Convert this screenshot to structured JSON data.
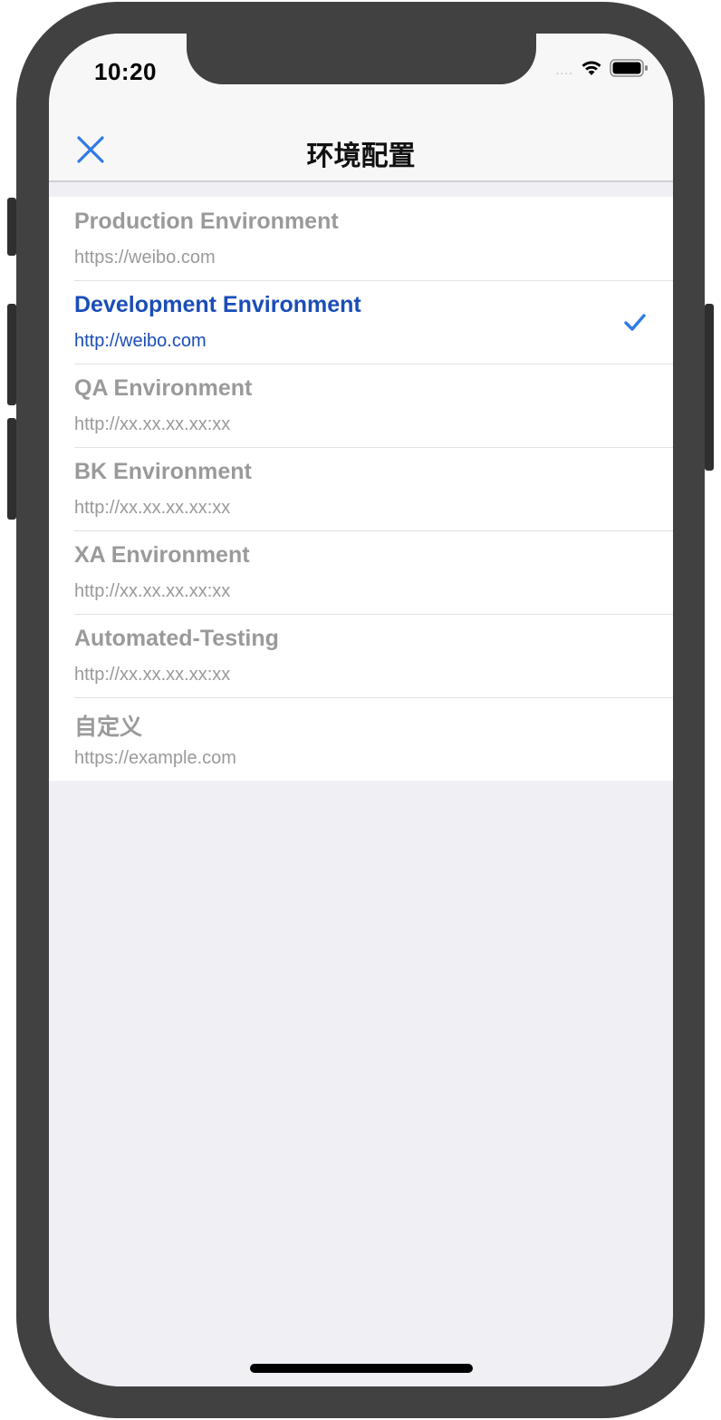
{
  "status_bar": {
    "time": "10:20",
    "signal": "....",
    "icons": [
      "wifi-icon",
      "battery-icon"
    ]
  },
  "nav": {
    "title": "环境配置",
    "close_icon": "close-icon"
  },
  "colors": {
    "accent": "#2f7ae5",
    "selected_text": "#1a4db8",
    "unselected_text": "#9a9a9a",
    "background": "#efeff4"
  },
  "environments": [
    {
      "title": "Production Environment",
      "url": "https://weibo.com",
      "selected": false
    },
    {
      "title": "Development Environment",
      "url": "http://weibo.com",
      "selected": true
    },
    {
      "title": "QA Environment",
      "url": "http://xx.xx.xx.xx:xx",
      "selected": false
    },
    {
      "title": "BK Environment",
      "url": "http://xx.xx.xx.xx:xx",
      "selected": false
    },
    {
      "title": "XA Environment",
      "url": "http://xx.xx.xx.xx:xx",
      "selected": false
    },
    {
      "title": "Automated-Testing",
      "url": "http://xx.xx.xx.xx:xx",
      "selected": false
    },
    {
      "title": "自定义",
      "url": "https://example.com",
      "selected": false
    }
  ]
}
